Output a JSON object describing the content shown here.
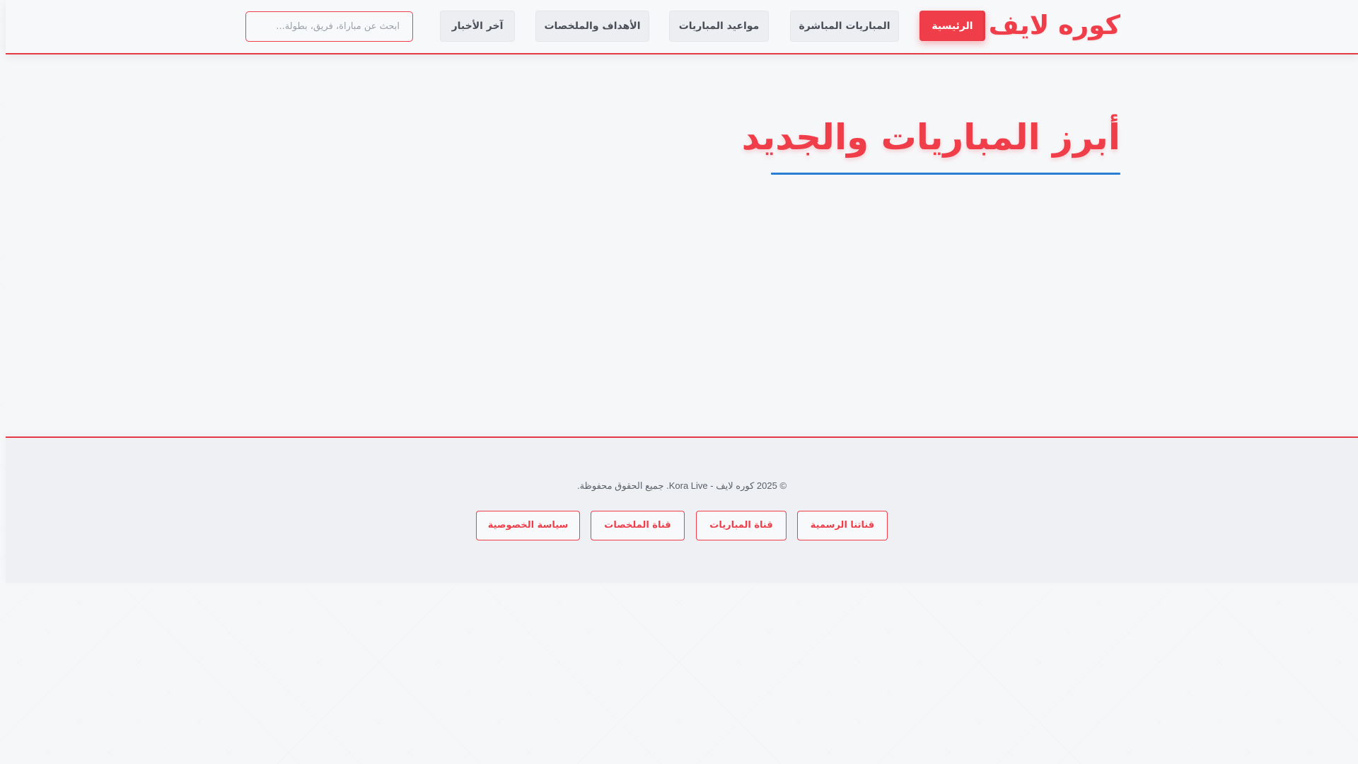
{
  "header": {
    "logo": "كوره لايف",
    "nav": [
      {
        "label": "الرئيسية",
        "active": true
      },
      {
        "label": "المباريات المباشرة",
        "active": false
      },
      {
        "label": "مواعيد المباريات",
        "active": false
      },
      {
        "label": "الأهداف والملخصات",
        "active": false
      },
      {
        "label": "آخر الأخبار",
        "active": false
      }
    ],
    "search": {
      "placeholder": "ابحث عن مباراة، فريق، بطولة...",
      "value": ""
    }
  },
  "main": {
    "title": "أبرز المباريات والجديد"
  },
  "footer": {
    "copyright": "© 2025 كوره لايف - Kora Live. جميع الحقوق محفوظة.",
    "links": [
      {
        "label": "قناتنا الرسمية"
      },
      {
        "label": "قناة المباريات"
      },
      {
        "label": "قناة الملخصات"
      },
      {
        "label": "سياسة الخصوصية"
      }
    ]
  },
  "colors": {
    "accent": "#ef3e49",
    "underline": "#2a7fd4",
    "background": "#f6f7f9"
  }
}
